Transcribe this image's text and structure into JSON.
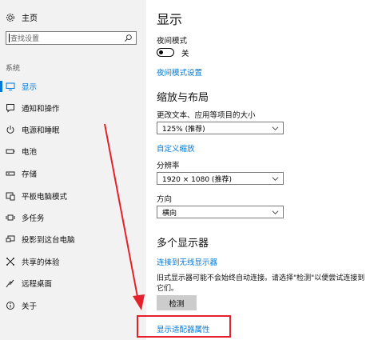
{
  "sidebar": {
    "home_label": "主页",
    "search_placeholder": "查找设置",
    "section_label": "系统",
    "items": [
      {
        "label": "显示",
        "icon": "display-icon"
      },
      {
        "label": "通知和操作",
        "icon": "notification-icon"
      },
      {
        "label": "电源和睡眠",
        "icon": "power-icon"
      },
      {
        "label": "电池",
        "icon": "battery-icon"
      },
      {
        "label": "存储",
        "icon": "storage-icon"
      },
      {
        "label": "平板电脑模式",
        "icon": "tablet-mode-icon"
      },
      {
        "label": "多任务",
        "icon": "multitasking-icon"
      },
      {
        "label": "投影到这台电脑",
        "icon": "projecting-icon"
      },
      {
        "label": "共享的体验",
        "icon": "shared-experiences-icon"
      },
      {
        "label": "远程桌面",
        "icon": "remote-desktop-icon"
      },
      {
        "label": "关于",
        "icon": "info-icon"
      }
    ]
  },
  "main": {
    "title": "显示",
    "night_light": {
      "label": "夜间模式",
      "toggle_text": "关",
      "settings_link": "夜间模式设置"
    },
    "scale_layout": {
      "heading": "缩放与布局",
      "text_size_label": "更改文本、应用等项目的大小",
      "text_size_value": "125% (推荐)",
      "custom_scaling_link": "自定义缩放",
      "resolution_label": "分辨率",
      "resolution_value": "1920 × 1080 (推荐)",
      "orientation_label": "方向",
      "orientation_value": "横向"
    },
    "multiple_displays": {
      "heading": "多个显示器",
      "wireless_link": "连接到无线显示器",
      "description": "旧式显示器可能不会始终自动连接。请选择\"检测\"以便尝试连接到它们。",
      "detect_button": "检测",
      "adapter_link": "显示适配器属性"
    }
  },
  "colors": {
    "accent": "#0078d7",
    "annotation": "#e5202a",
    "sidebar_bg": "#f2f2f2"
  }
}
